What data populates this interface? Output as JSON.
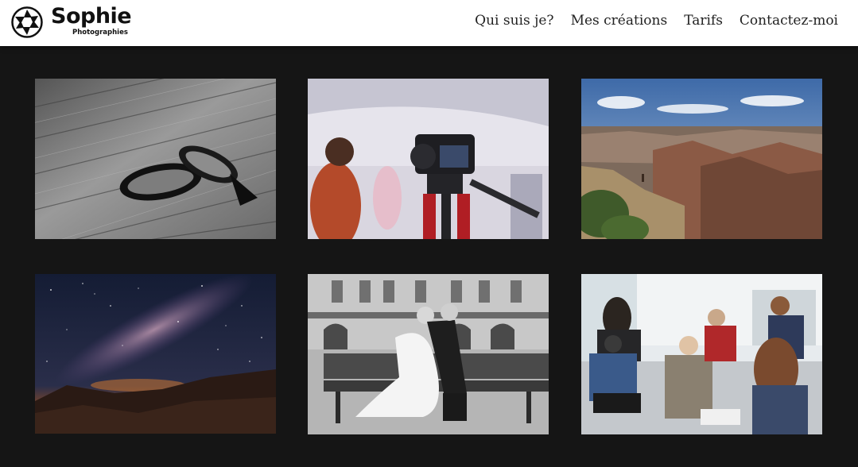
{
  "brand": {
    "name": "Sophie",
    "subtitle": "Photographies"
  },
  "nav": {
    "items": [
      {
        "label": "Qui suis je?"
      },
      {
        "label": "Mes créations"
      },
      {
        "label": "Tarifs"
      },
      {
        "label": "Contactez-moi"
      }
    ]
  },
  "icons": {
    "logo": "camera-aperture-icon"
  },
  "colors": {
    "header_bg": "#ffffff",
    "page_bg": "#151515",
    "nav_text": "#222222"
  }
}
